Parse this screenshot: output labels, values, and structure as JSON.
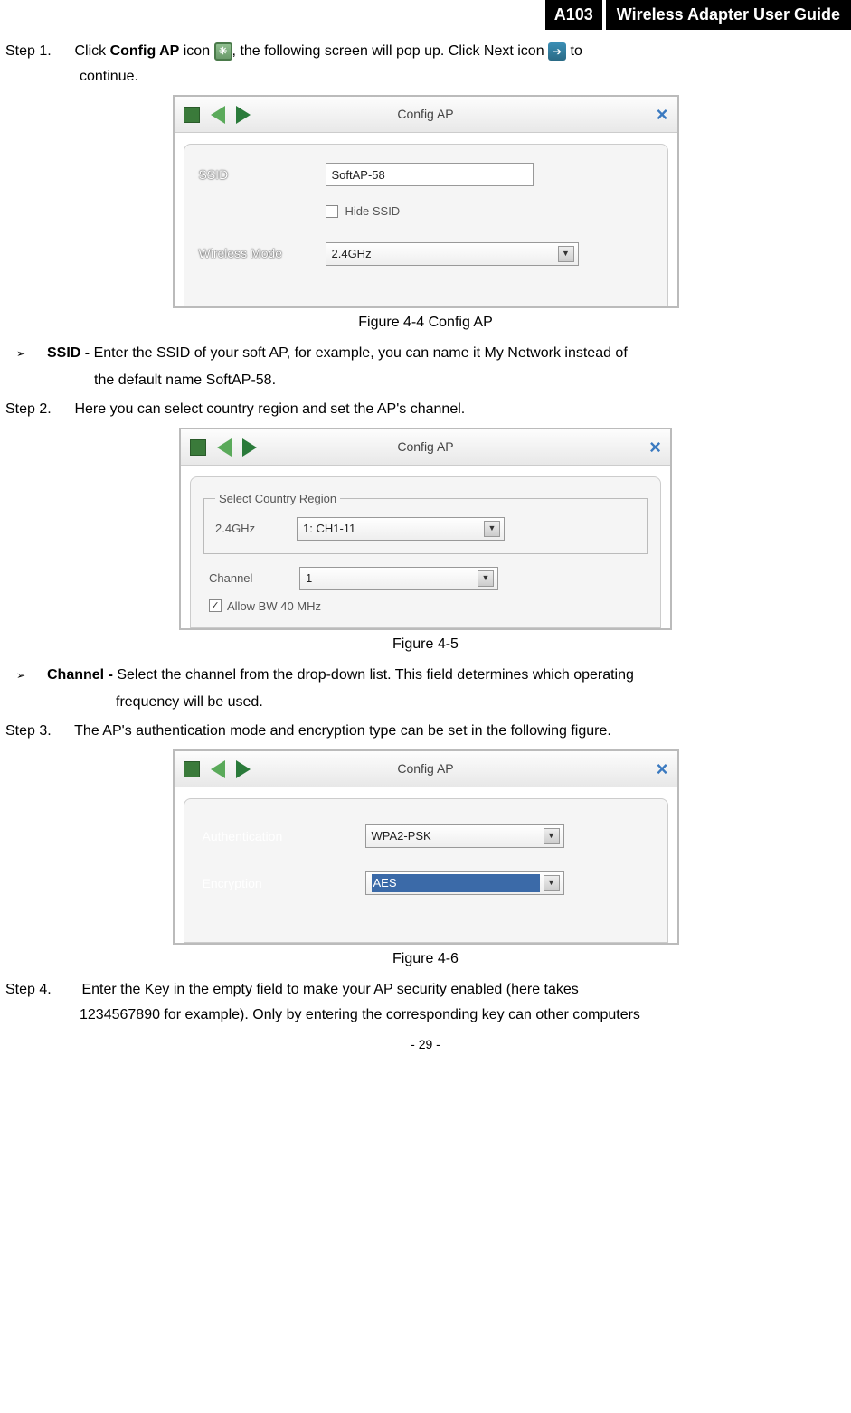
{
  "header": {
    "code": "A103",
    "title": "Wireless Adapter User Guide"
  },
  "step1": {
    "label": "Step 1.",
    "pre": "Click ",
    "bold": "Config AP",
    "mid1": " icon ",
    "mid2": ", the following screen will pop up. Click Next icon ",
    "mid3": " to",
    "cont": "continue."
  },
  "fig4_4": {
    "title": "Config AP",
    "ssid_label": "SSID",
    "ssid_value": "SoftAP-58",
    "hide_ssid_label": "Hide SSID",
    "hide_ssid_checked": false,
    "wireless_mode_label": "Wireless Mode",
    "wireless_mode_value": "2.4GHz",
    "caption": "Figure 4-4 Config AP"
  },
  "ssid_bullet": {
    "lead": "SSID - ",
    "body1": "Enter the SSID of your soft AP, for example, you can name it My Network instead of",
    "body2": "the default name SoftAP-58."
  },
  "step2": {
    "label": "Step 2.",
    "body": "Here you can select country region and set the AP's channel."
  },
  "fig4_5": {
    "title": "Config AP",
    "region_legend": "Select Country Region",
    "region_band_label": "2.4GHz",
    "region_value": "1: CH1-11",
    "channel_label": "Channel",
    "channel_value": "1",
    "allow_bw_label": "Allow BW 40 MHz",
    "allow_bw_checked": true,
    "caption": "Figure 4-5"
  },
  "channel_bullet": {
    "lead": "Channel - ",
    "body1": "Select the channel from the drop-down list. This field determines which operating",
    "body2": "frequency will be used."
  },
  "step3": {
    "label": "Step 3.",
    "body": "The AP's authentication mode and encryption type can be set in the following figure."
  },
  "fig4_6": {
    "title": "Config AP",
    "auth_label": "Authentication",
    "auth_value": "WPA2-PSK",
    "enc_label": "Encryption",
    "enc_value": "AES",
    "caption": "Figure 4-6"
  },
  "step4": {
    "label": "Step 4.",
    "body1": "Enter the Key in the empty field to make your AP security enabled (here takes",
    "body2": "1234567890 for example). Only by entering the corresponding key can other computers"
  },
  "page_number": "- 29 -"
}
